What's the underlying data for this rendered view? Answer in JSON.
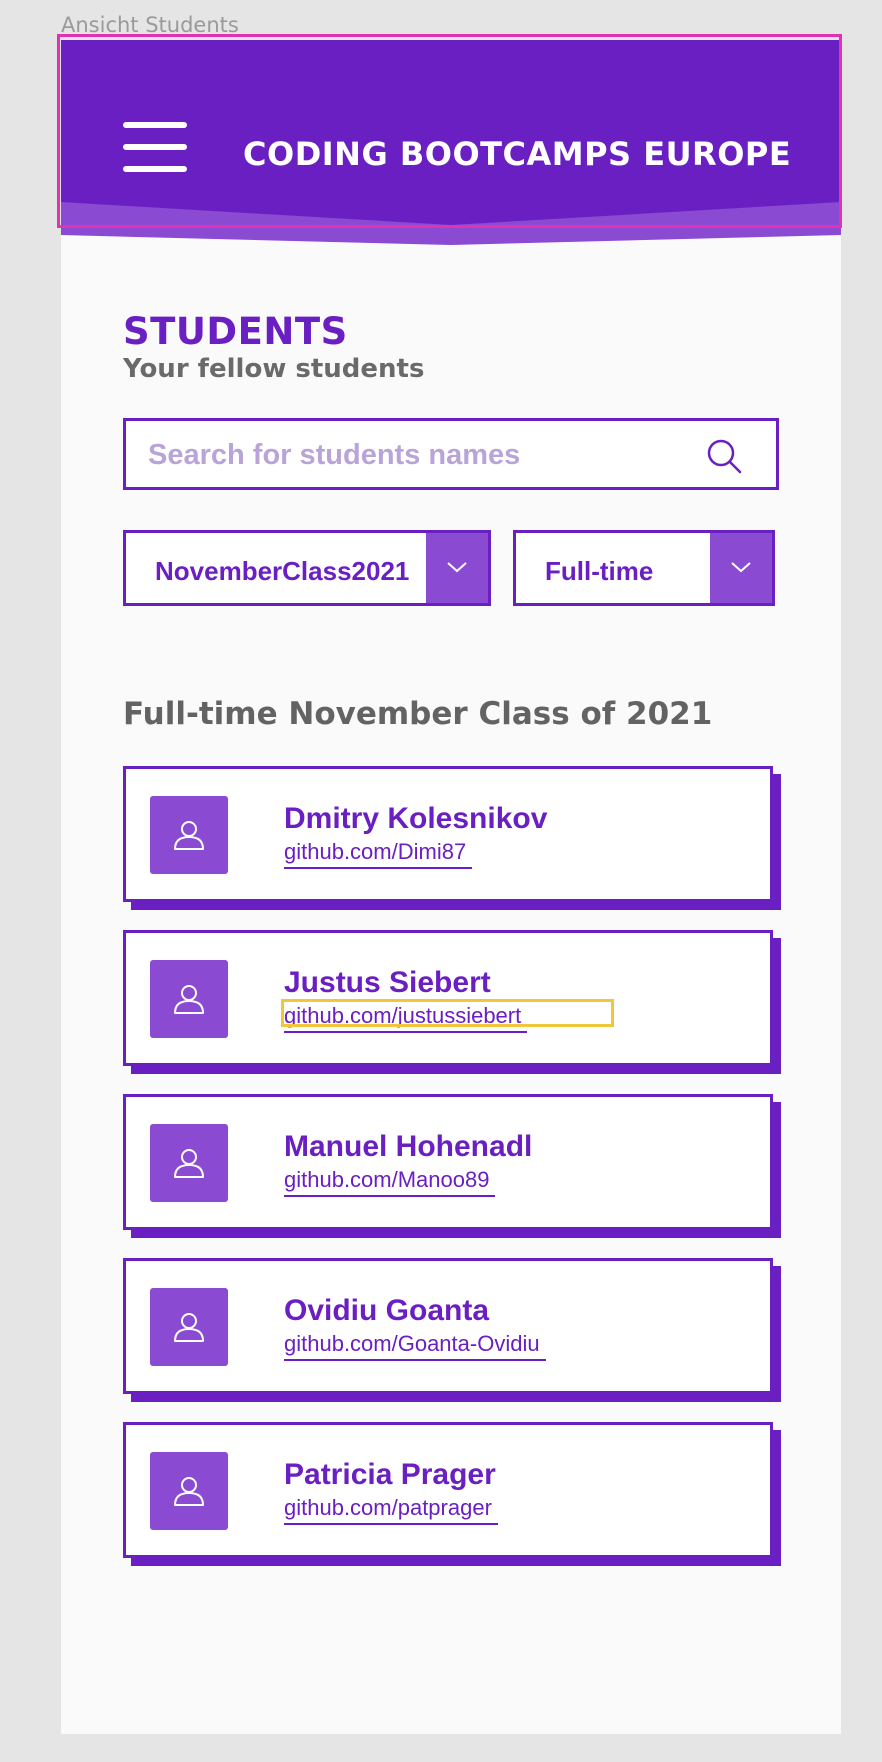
{
  "frame": {
    "label": "Ansicht Students"
  },
  "header": {
    "brand": "CODING BOOTCAMPS EUROPE",
    "menu_icon": "hamburger-menu-icon",
    "color": "#6a1fc2",
    "fold_color": "#8a4ad1"
  },
  "page": {
    "title": "STUDENTS",
    "subtitle": "Your fellow students"
  },
  "search": {
    "placeholder": "Search for students names",
    "value": "",
    "icon": "search-icon"
  },
  "filters": {
    "class": {
      "value": "NovemberClass2021",
      "icon": "chevron-down-icon"
    },
    "type": {
      "value": "Full-time",
      "icon": "chevron-down-icon"
    }
  },
  "section": {
    "heading": "Full-time November Class of 2021"
  },
  "students": [
    {
      "name": "Dmitry Kolesnikov",
      "github": "github.com/Dimi87",
      "avatar_icon": "user-icon"
    },
    {
      "name": "Justus Siebert",
      "github": "github.com/justussiebert",
      "avatar_icon": "user-icon"
    },
    {
      "name": "Manuel Hohenadl",
      "github": "github.com/Manoo89",
      "avatar_icon": "user-icon"
    },
    {
      "name": "Ovidiu Goanta",
      "github": "github.com/Goanta-Ovidiu",
      "avatar_icon": "user-icon"
    },
    {
      "name": "Patricia Prager",
      "github": "github.com/patprager",
      "avatar_icon": "user-icon"
    }
  ],
  "colors": {
    "primary": "#6a1fc2",
    "secondary": "#8a4ad1",
    "placeholder": "#b8a4d8",
    "selection": "#e232b4",
    "focus": "#f0c63a"
  }
}
